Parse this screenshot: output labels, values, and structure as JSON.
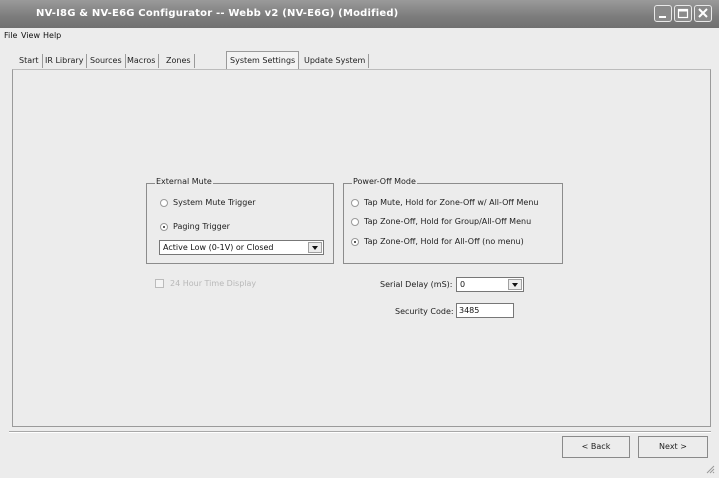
{
  "window": {
    "title": "NV-I8G & NV-E6G Configurator -- Webb v2 (NV-E6G) (Modified)",
    "controls": {
      "minimize": "minimize-icon",
      "maximize": "maximize-icon",
      "close": "close-icon"
    }
  },
  "menu": [
    "File",
    "View",
    "Help"
  ],
  "tabs": [
    "Start",
    "IR Library",
    "Sources",
    "Macros",
    "Zones",
    "System Settings",
    "Update System"
  ],
  "active_tab": "System Settings",
  "external_mute": {
    "title": "External Mute",
    "options": [
      "System Mute Trigger",
      "Paging Trigger"
    ],
    "selected": "Paging Trigger",
    "trigger_mode": "Active Low (0-1V) or Closed"
  },
  "power_off": {
    "title": "Power-Off Mode",
    "options": [
      "Tap Mute, Hold for Zone-Off w/ All-Off Menu",
      "Tap Zone-Off, Hold for Group/All-Off Menu",
      "Tap Zone-Off, Hold for All-Off (no menu)"
    ],
    "selected": "Tap Zone-Off, Hold for All-Off (no menu)"
  },
  "time_display": {
    "label": "24 Hour Time Display",
    "checked": false,
    "enabled": false
  },
  "serial_delay": {
    "label": "Serial Delay (mS):",
    "value": "0"
  },
  "security_code": {
    "label": "Security Code:",
    "value": "3485"
  },
  "buttons": {
    "back": "< Back",
    "next": "Next >"
  }
}
